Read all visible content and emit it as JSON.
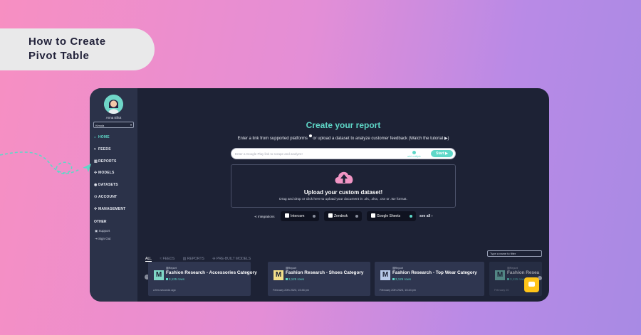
{
  "banner": {
    "line1": "How to Create",
    "line2": "Pivot Table"
  },
  "user": {
    "name": "Anna Elliot",
    "org": "Kimola"
  },
  "nav": [
    {
      "label": "HOME",
      "icon": "home-icon",
      "glyph": "⌂",
      "active": true
    },
    {
      "label": "FEEDS",
      "icon": "feeds-icon",
      "glyph": "≈",
      "active": false
    },
    {
      "label": "REPORTS",
      "icon": "reports-icon",
      "glyph": "▥",
      "active": false
    },
    {
      "label": "MODELS",
      "icon": "models-icon",
      "glyph": "✣",
      "active": false
    },
    {
      "label": "DATASETS",
      "icon": "datasets-icon",
      "glyph": "◉",
      "active": false
    },
    {
      "label": "ACCOUNT",
      "icon": "account-icon",
      "glyph": "⚇",
      "active": false
    },
    {
      "label": "MANAGEMENT",
      "icon": "management-icon",
      "glyph": "✣",
      "active": false
    }
  ],
  "other": {
    "label": "OTHER",
    "support": "Support",
    "signout": "Sign Out"
  },
  "main": {
    "title": "Create your report",
    "subtitle_a": "Enter a link from supported platforms",
    "subtitle_b": " or upload a dataset to analyze customer feedback (Watch the tutorial",
    "subtitle_c": ")"
  },
  "search": {
    "placeholder": "Enter a Google Play link to scrape and analyze!",
    "add_multiple": "add multiple",
    "start": "Start"
  },
  "upload": {
    "title": "Upload your custom dataset!",
    "desc": "Drag and drop or click here to upload your document in .xls, .xlsx, .csv or .tsv format."
  },
  "integrations": {
    "label": "Integrations",
    "intercom": "Intercom",
    "zendesk": "Zendesk",
    "sheets": "Google Sheets",
    "see_all": "see all"
  },
  "tabs": [
    "ALL",
    "FEEDS",
    "REPORTS",
    "PRE-BUILT MODELS"
  ],
  "filter_placeholder": "Type a name to filter",
  "cards": [
    {
      "letter": "M",
      "type": "Report",
      "name": "Fashion Research - Accessories Category",
      "rows": "3,125 rows",
      "date": "a few seconds ago",
      "color": "#7fd8c6"
    },
    {
      "letter": "M",
      "type": "Report",
      "name": "Fashion Research - Shoes Category",
      "rows": "3,125 rows",
      "date": "February 20th 2023, 15:46 pm",
      "color": "#f3e08a"
    },
    {
      "letter": "M",
      "type": "Report",
      "name": "Fashion Research - Top Wear Category",
      "rows": "3,125 rows",
      "date": "February 20th 2023, 15:44 pm",
      "color": "#b8c9e8"
    },
    {
      "letter": "M",
      "type": "Report",
      "name": "Fashion Resea",
      "rows": "3,125 rows",
      "date": "February 20",
      "color": "#7fd8c6"
    }
  ],
  "colors": {
    "accent": "#5fd8c8",
    "window_bg": "#1d2235",
    "sidebar_bg": "#2b3249",
    "chat": "#ffc419"
  }
}
